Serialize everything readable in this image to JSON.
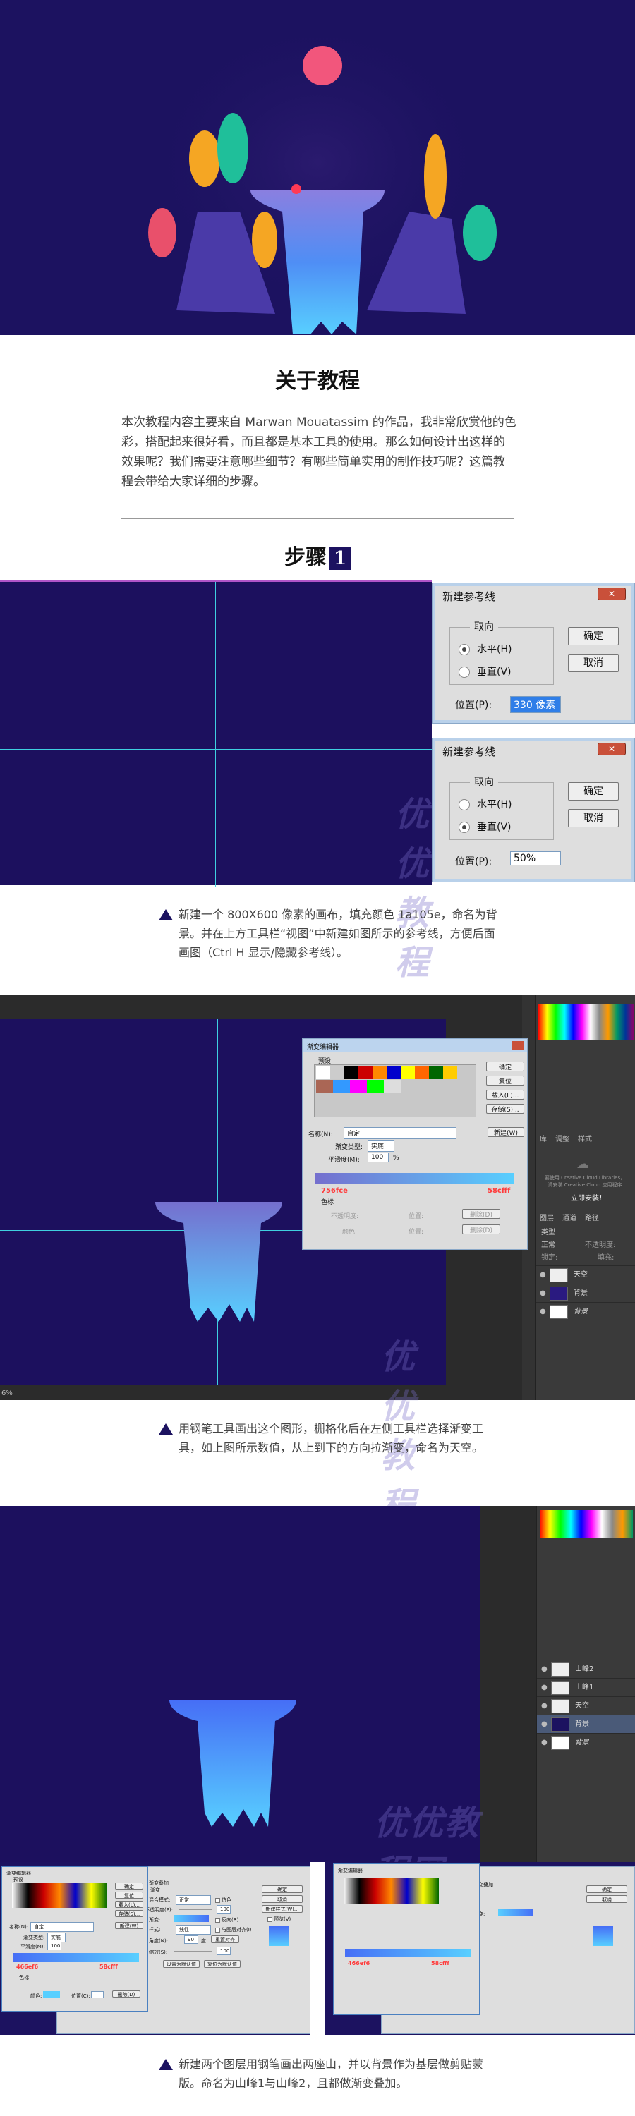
{
  "hero": {
    "alt_description_none": ""
  },
  "about": {
    "title": "关于教程",
    "paragraph": "本次教程内容主要来自 Marwan Mouatassim 的作品，我非常欣赏他的色彩，搭配起来很好看，而且都是基本工具的使用。那么如何设计出这样的效果呢？我们需要注意哪些细节？有哪些简单实用的制作技巧呢？这篇教程会带给大家详细的步骤。"
  },
  "step1": {
    "heading": "步骤",
    "number": "1",
    "dialog_a": {
      "title": "新建参考线",
      "close": "✕",
      "group": "取向",
      "horizontal": "水平(H)",
      "vertical": "垂直(V)",
      "selected": "horizontal",
      "ok": "确定",
      "cancel": "取消",
      "position_label": "位置(P):",
      "position_value": "330 像素"
    },
    "dialog_b": {
      "title": "新建参考线",
      "close": "✕",
      "group": "取向",
      "horizontal": "水平(H)",
      "vertical": "垂直(V)",
      "selected": "vertical",
      "ok": "确定",
      "cancel": "取消",
      "position_label": "位置(P):",
      "position_value": "50%"
    },
    "watermark": "优优教程网",
    "caption": "新建一个 800X600 像素的画布，填充颜色 1a105e，命名为背景。并在上方工具栏“视图”中新建如图所示的参考线，方便后面画图（Ctrl H 显示/隐藏参考线）。"
  },
  "step2": {
    "gradient_editor": {
      "title": "渐变编辑器",
      "presets_label": "预设",
      "ok": "确定",
      "reset": "复位",
      "load": "载入(L)...",
      "save": "存储(S)...",
      "name_label": "名称(N):",
      "name_value": "自定",
      "new": "新建(W)",
      "type_label": "渐变类型:",
      "type_value": "实底",
      "smooth_label": "平滑度(M):",
      "smooth_value": "100",
      "percent": "%",
      "stop_left": "756fce",
      "stop_right": "58cfff",
      "stops_label": "色标",
      "opacity_label": "不透明度:",
      "color_label": "颜色:",
      "location_label": "位置:",
      "delete": "删除(D)"
    },
    "library": {
      "tabs": [
        "库",
        "调整",
        "样式"
      ],
      "msg1": "要使用 Creative Cloud Libraries，",
      "msg2": "请安装 Creative Cloud 应用程序",
      "install": "立即安装！"
    },
    "layers": {
      "tabs": [
        "图层",
        "通道",
        "路径"
      ],
      "kind": "类型",
      "blend": "正常",
      "opacity": "不透明度:",
      "lock": "锁定:",
      "fill": "填充:",
      "items": [
        "天空",
        "背景",
        "背景"
      ]
    },
    "status": "6%",
    "watermark": "优优教程网",
    "caption": "用钢笔工具画出这个图形，栅格化后在左侧工具栏选择渐变工具，如上图所示数值，从上到下的方向拉渐变，命名为天空。"
  },
  "step3": {
    "layers": {
      "items": [
        "山峰2",
        "山峰1",
        "天空",
        "背景",
        "背景"
      ]
    },
    "gradient_editor": {
      "title": "渐变编辑器",
      "presets_label": "预设",
      "ok": "确定",
      "reset": "复位",
      "load": "载入(L)...",
      "save": "存储(S)...",
      "name_label": "名称(N):",
      "name_value": "自定",
      "new": "新建(W)",
      "type_label": "渐变类型:",
      "type_value": "实底",
      "smooth_label": "平滑度(M):",
      "smooth_value": "100",
      "stop_left": "466ef6",
      "stop_right": "58cfff",
      "stops_label": "色标",
      "color_label": "颜色:",
      "location_label": "位置(C):",
      "delete": "删除(D)"
    },
    "overlay": {
      "section": "渐变叠加",
      "sub": "渐变",
      "blend_label": "混合模式:",
      "blend_value": "正常",
      "dither": "仿色",
      "opacity_label": "不透明度(P):",
      "opacity_value": "100",
      "gradient_label": "渐变:",
      "reverse": "反向(R)",
      "style_label": "样式:",
      "style_value": "线性",
      "align": "与图层对齐(I)",
      "angle_label": "角度(N):",
      "angle_value": "90",
      "deg": "度",
      "reset_align": "重置对齐",
      "scale_label": "缩放(S):",
      "scale_value": "100",
      "set_default": "设置为默认值",
      "reset_default": "复位为默认值",
      "ok": "确定",
      "cancel": "取消",
      "new_style": "新建样式(W)...",
      "preview": "预览(V)"
    },
    "watermark": "优优教程网",
    "caption": "新建两个图层用钢笔画出两座山，并以背景作为基层做剪贴蒙版。命名为山峰1与山峰2，且都做渐变叠加。"
  },
  "colors": {
    "brand": "#1c1260",
    "canvas": "#1a105e",
    "guide": "#3fd0e0",
    "accent_text": "#ff3b3b"
  }
}
